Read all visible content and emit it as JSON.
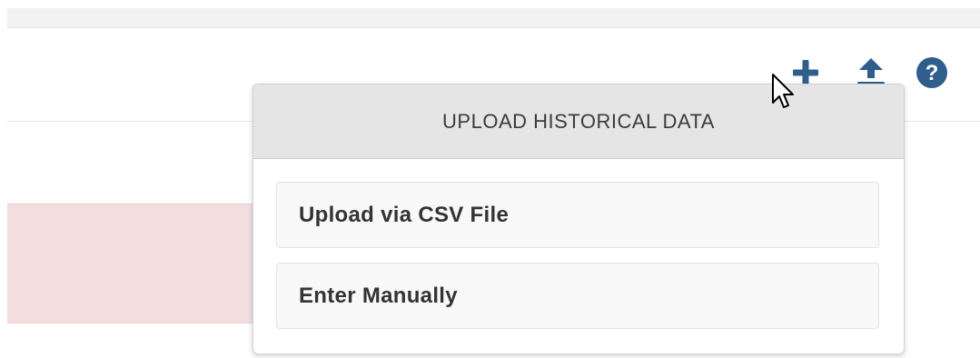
{
  "toolbar": {
    "add_icon": "plus-icon",
    "upload_icon": "upload-icon",
    "help_icon": "question-circle-icon",
    "icon_color": "#2f5d8c"
  },
  "popover": {
    "title": "UPLOAD HISTORICAL DATA",
    "options": [
      {
        "label": "Upload via CSV File"
      },
      {
        "label": "Enter Manually"
      }
    ]
  },
  "colors": {
    "alert_background": "#f2dede",
    "header_background": "#e5e5e5"
  }
}
